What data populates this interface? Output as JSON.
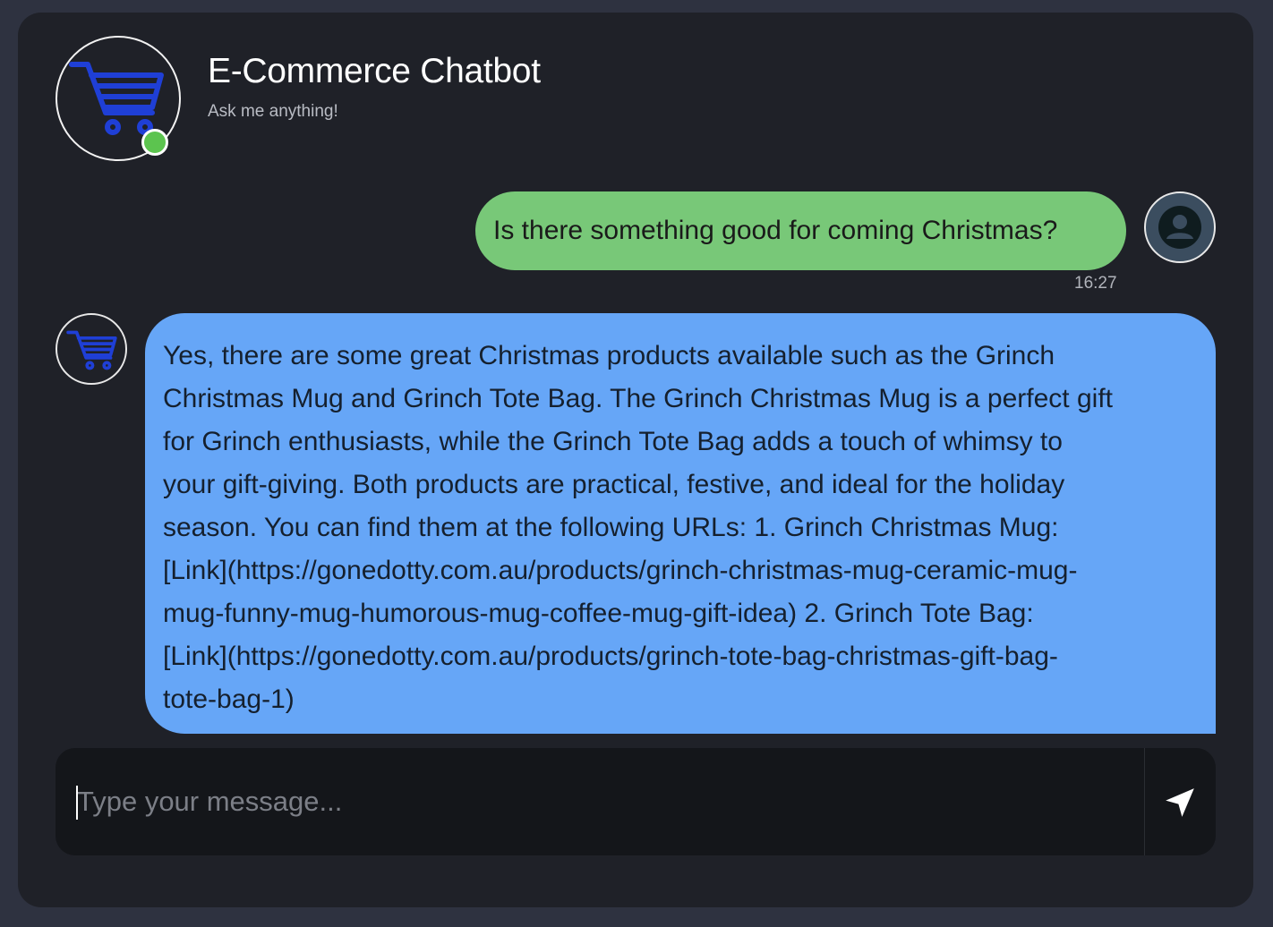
{
  "header": {
    "title": "E-Commerce Chatbot",
    "subtitle": "Ask me anything!",
    "status": "online",
    "logo_icon": "shopping-cart-icon",
    "colors": {
      "cart": "#1f3fd6",
      "online": "#5cc44f"
    }
  },
  "messages": [
    {
      "role": "user",
      "text": "Is there something good for coming Christmas?",
      "time": "16:27",
      "avatar_icon": "user-icon",
      "bubble_color": "#78c878"
    },
    {
      "role": "bot",
      "avatar_icon": "shopping-cart-icon",
      "bubble_color": "#66a6f7",
      "lines": [
        "Yes, there are some great Christmas products available such as the Grinch",
        "Christmas Mug and Grinch Tote Bag. The Grinch Christmas Mug is a perfect gift",
        "for Grinch enthusiasts, while the Grinch Tote Bag adds a touch of whimsy to",
        "your gift-giving. Both products are practical, festive, and ideal for the holiday",
        "season. You can find them at the following URLs: 1. Grinch Christmas Mug:",
        "[Link](https://gonedotty.com.au/products/grinch-christmas-mug-ceramic-mug-",
        "mug-funny-mug-humorous-mug-coffee-mug-gift-idea) 2. Grinch Tote Bag:",
        "[Link](https://gonedotty.com.au/products/grinch-tote-bag-christmas-gift-bag-",
        "tote-bag-1)"
      ]
    }
  ],
  "composer": {
    "placeholder": "Type your message...",
    "value": "",
    "send_icon": "send-icon"
  }
}
